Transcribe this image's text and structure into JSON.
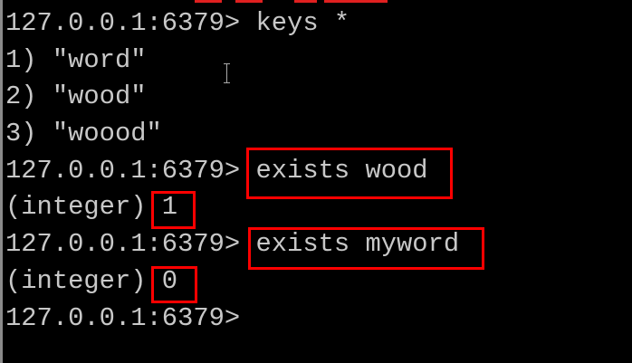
{
  "terminal": {
    "lines": [
      "127.0.0.1:6379> keys *",
      "1) \"word\"",
      "2) \"wood\"",
      "3) \"woood\"",
      "127.0.0.1:6379> exists wood",
      "(integer) 1",
      "127.0.0.1:6379> exists myword",
      "(integer) 0",
      "127.0.0.1:6379> "
    ]
  },
  "colors": {
    "text": "#c8c8c8",
    "background": "#000000",
    "highlight": "#ff0000"
  }
}
